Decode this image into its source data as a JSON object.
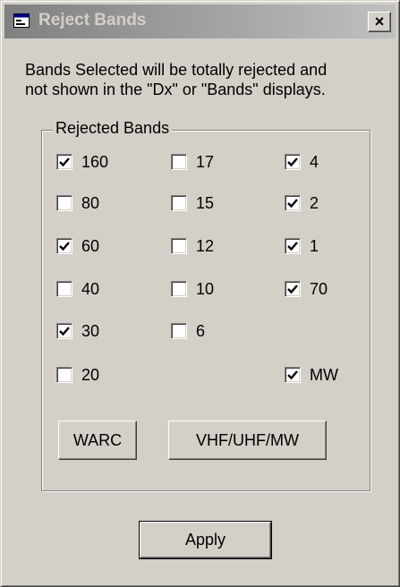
{
  "window": {
    "title": "Reject Bands",
    "close_label": "×"
  },
  "description": {
    "line1": "Bands Selected will be totally rejected and",
    "line2": "not shown in the \"Dx\" or \"Bands\" displays."
  },
  "group": {
    "label": "Rejected Bands",
    "bands": [
      {
        "label": "160",
        "checked": true
      },
      {
        "label": "80",
        "checked": false
      },
      {
        "label": "60",
        "checked": true
      },
      {
        "label": "40",
        "checked": false
      },
      {
        "label": "30",
        "checked": true
      },
      {
        "label": "20",
        "checked": false
      },
      {
        "label": "17",
        "checked": false
      },
      {
        "label": "15",
        "checked": false
      },
      {
        "label": "12",
        "checked": false
      },
      {
        "label": "10",
        "checked": false
      },
      {
        "label": "6",
        "checked": false
      },
      {
        "label": "4",
        "checked": true
      },
      {
        "label": "2",
        "checked": true
      },
      {
        "label": "1",
        "checked": true
      },
      {
        "label": "70",
        "checked": true
      },
      {
        "label": "MW",
        "checked": true
      }
    ],
    "warc_button": "WARC",
    "vhf_button": "VHF/UHF/MW"
  },
  "apply_button": "Apply",
  "colors": {
    "face": "#d4d0c8",
    "titlebar_start": "#808080",
    "titlebar_end": "#c0c0c0"
  }
}
